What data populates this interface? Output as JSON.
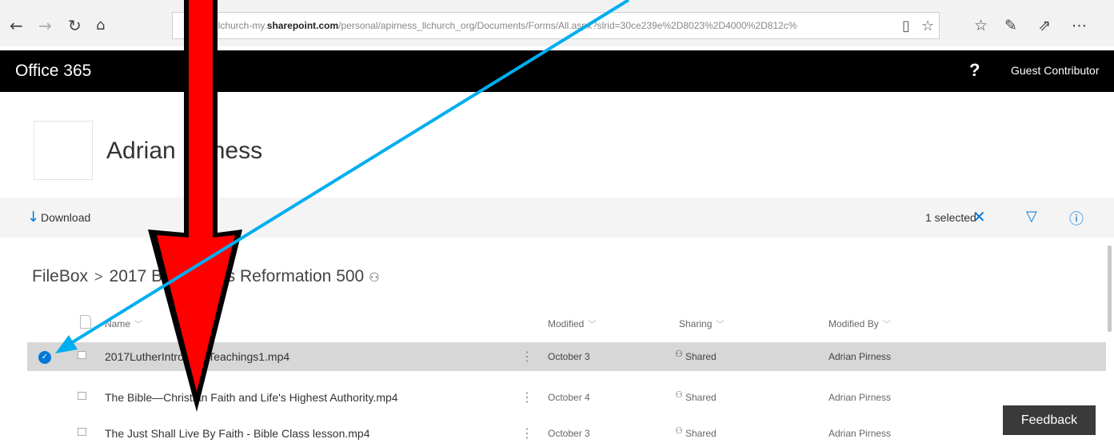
{
  "browser": {
    "url_prefix": "llchurch-my.",
    "url_domain": "sharepoint.com",
    "url_rest": "/personal/apirness_llchurch_org/Documents/Forms/All.aspx?slrid=30ce239e%2D8023%2D4000%2D812c%",
    "icons": {
      "back": "back-arrow-icon",
      "forward": "forward-arrow-icon",
      "refresh": "refresh-icon",
      "home": "home-icon",
      "reading_view": "reading-view-icon",
      "favorite": "star-icon",
      "favorites_hub": "favorites-hub-icon",
      "notes": "pen-icon",
      "share": "share-icon",
      "more": "more-icon"
    }
  },
  "header": {
    "app_title": "Office 365",
    "help": "?",
    "user": "Guest Contributor"
  },
  "site": {
    "title": "Adrian Pirness"
  },
  "commandbar": {
    "download": "Download",
    "selected": "1 selected"
  },
  "breadcrumb": {
    "root": "FileBox",
    "separator": ">",
    "folder": "2017 Bible Class Reformation 500"
  },
  "columns": {
    "name": "Name",
    "modified": "Modified",
    "sharing": "Sharing",
    "modified_by": "Modified By"
  },
  "files": [
    {
      "name": "2017LutherIntro_LifeTeachings1.mp4",
      "modified": "October 3",
      "sharing": "Shared",
      "modified_by": "Adrian Pirness",
      "selected": true
    },
    {
      "name": "The Bible—Christian Faith and Life's Highest Authority.mp4",
      "modified": "October 4",
      "sharing": "Shared",
      "modified_by": "Adrian Pirness",
      "selected": false
    },
    {
      "name": "The Just Shall Live By Faith - Bible Class lesson.mp4",
      "modified": "October 3",
      "sharing": "Shared",
      "modified_by": "Adrian Pirness",
      "selected": false
    }
  ],
  "feedback": "Feedback",
  "colors": {
    "accent": "#0078d7",
    "header_bg": "#000000",
    "selected_row": "#d7d7d7",
    "annotation_red": "#ff0000",
    "annotation_blue": "#00aeef"
  }
}
